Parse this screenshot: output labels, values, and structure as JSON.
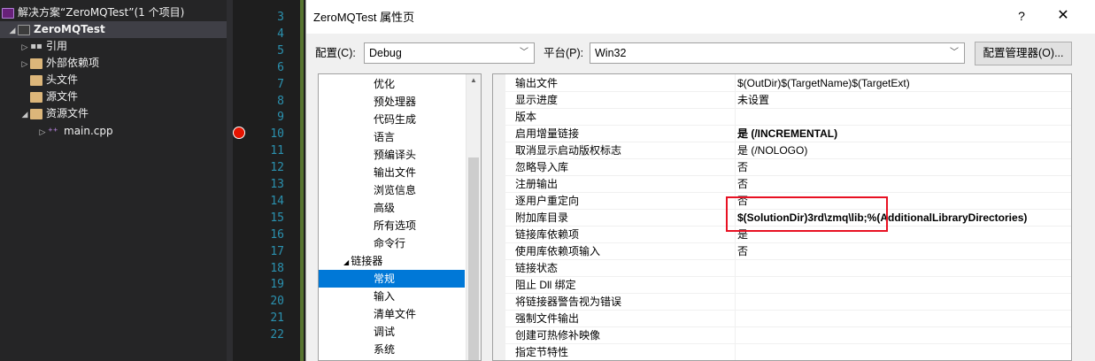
{
  "solution_explorer": {
    "items": [
      {
        "label": "解决方案“ZeroMQTest”(1 个项目)",
        "icon": "solution-icon",
        "depth": 0
      },
      {
        "label": "ZeroMQTest",
        "icon": "project-icon",
        "depth": 0,
        "expanded": true,
        "selected": true
      },
      {
        "label": "引用",
        "icon": "references-icon",
        "depth": 1
      },
      {
        "label": "外部依赖项",
        "icon": "folder-icon",
        "depth": 1
      },
      {
        "label": "头文件",
        "icon": "folder-icon",
        "depth": 1
      },
      {
        "label": "源文件",
        "icon": "folder-icon",
        "depth": 1
      },
      {
        "label": "资源文件",
        "icon": "folder-icon",
        "depth": 1,
        "expanded": true
      },
      {
        "label": "main.cpp",
        "icon": "cpp-file-icon",
        "depth": 2
      }
    ]
  },
  "editor": {
    "line_numbers": [
      "3",
      "4",
      "5",
      "6",
      "7",
      "8",
      "9",
      "10",
      "11",
      "12",
      "13",
      "14",
      "15",
      "16",
      "17",
      "18",
      "19",
      "20",
      "21",
      "22"
    ],
    "breakpoint_line": "10"
  },
  "dialog": {
    "title": "ZeroMQTest 属性页",
    "help_label": "?",
    "close_label": "✕",
    "config_label": "配置(C):",
    "config_value": "Debug",
    "platform_label": "平台(P):",
    "platform_value": "Win32",
    "config_manager_label": "配置管理器(O)...",
    "nav": {
      "items": [
        {
          "label": "优化",
          "depth": 2
        },
        {
          "label": "预处理器",
          "depth": 2
        },
        {
          "label": "代码生成",
          "depth": 2
        },
        {
          "label": "语言",
          "depth": 2
        },
        {
          "label": "预编译头",
          "depth": 2
        },
        {
          "label": "输出文件",
          "depth": 2
        },
        {
          "label": "浏览信息",
          "depth": 2
        },
        {
          "label": "高级",
          "depth": 2
        },
        {
          "label": "所有选项",
          "depth": 2
        },
        {
          "label": "命令行",
          "depth": 2
        },
        {
          "label": "链接器",
          "depth": 1,
          "expanded": true
        },
        {
          "label": "常规",
          "depth": 2,
          "selected": true
        },
        {
          "label": "输入",
          "depth": 2
        },
        {
          "label": "清单文件",
          "depth": 2
        },
        {
          "label": "调试",
          "depth": 2
        },
        {
          "label": "系统",
          "depth": 2
        }
      ]
    },
    "properties": [
      {
        "name": "输出文件",
        "value": "$(OutDir)$(TargetName)$(TargetExt)",
        "bold": false
      },
      {
        "name": "显示进度",
        "value": "未设置",
        "bold": false
      },
      {
        "name": "版本",
        "value": "",
        "bold": false
      },
      {
        "name": "启用增量链接",
        "value": "是 (/INCREMENTAL)",
        "bold": true
      },
      {
        "name": "取消显示启动版权标志",
        "value": "是 (/NOLOGO)",
        "bold": false
      },
      {
        "name": "忽略导入库",
        "value": "否",
        "bold": false
      },
      {
        "name": "注册输出",
        "value": "否",
        "bold": false
      },
      {
        "name": "逐用户重定向",
        "value": "否",
        "bold": false
      },
      {
        "name": "附加库目录",
        "value": "$(SolutionDir)3rd\\zmq\\lib;%(AdditionalLibraryDirectories)",
        "bold": true
      },
      {
        "name": "链接库依赖项",
        "value": "是",
        "bold": false
      },
      {
        "name": "使用库依赖项输入",
        "value": "否",
        "bold": false
      },
      {
        "name": "链接状态",
        "value": "",
        "bold": false
      },
      {
        "name": "阻止 Dll 绑定",
        "value": "",
        "bold": false
      },
      {
        "name": "将链接器警告视为错误",
        "value": "",
        "bold": false
      },
      {
        "name": "强制文件输出",
        "value": "",
        "bold": false
      },
      {
        "name": "创建可热修补映像",
        "value": "",
        "bold": false
      },
      {
        "name": "指定节特性",
        "value": "",
        "bold": false
      }
    ],
    "highlight_color": "#e81123"
  },
  "colors": {
    "selection": "#0078d7",
    "line_number": "#2b91af",
    "breakpoint": "#e51400"
  }
}
